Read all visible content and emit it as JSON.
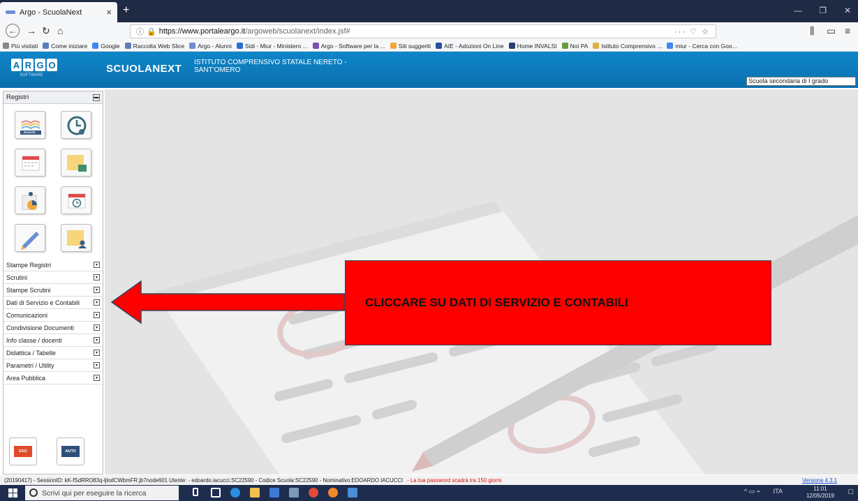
{
  "browser": {
    "tab_title": "Argo - ScuolaNext",
    "tab_close": "×",
    "new_tab": "+",
    "url_host": "https://www.portaleargo.it",
    "url_path": "/argoweb/scuolanext/index.jsf#",
    "url_actions": "··· ♡ ☆",
    "bookmarks": [
      "Più visitati",
      "Come iniziare",
      "Google",
      "Raccolta Web Slice",
      "Argo - Alunni",
      "Sidi - Miur - Ministero ...",
      "Argo - Software per la ...",
      "Siti suggeriti",
      "AIE - Adozioni On Line",
      "Home INVALSI",
      "Noi PA",
      "Istituto Comprensivo ...",
      "miur - Cerca con Goo..."
    ]
  },
  "app": {
    "logo_letters": [
      "A",
      "R",
      "G",
      "O"
    ],
    "logo_sub": "SOFTWARE",
    "product": "SCUOLANEXT",
    "school_line1": "ISTITUTO COMPRENSIVO STATALE NERETO -",
    "school_line2": "SANT'OMERO",
    "school_level": "Scuola secondaria di I grado"
  },
  "sidebar": {
    "registri_label": "Registri",
    "registri_icon_caption": "REGISTRI",
    "menu": [
      "Stampe Registri",
      "Scrutini",
      "Stampe Scrutini",
      "Dati di Servizio e Contabili",
      "Comunicazioni",
      "Condivisione Documenti",
      "Info classe / docenti",
      "Didattica / Tabelle",
      "Parametri / Utility",
      "Area Pubblica"
    ],
    "exit_label": "ESCI",
    "help_label": "AIUTO"
  },
  "annotation": {
    "text": "CLICCARE SU DATI DI SERVIZIO E CONTABILI",
    "color": "#ff0000"
  },
  "status": {
    "session": "(20190417) - SessionID: kK-fSdRRO83q-ljlodCWbmFR.jb7node601 Utente: - edoardo.iacucci.SC22590 - Codice Scuola:SC22590 - Nominativo:EDOARDO IACUCCI",
    "warning": "- La tua password scadrà tra 150 giorni",
    "version": "Versione 4.3.1"
  },
  "taskbar": {
    "search_placeholder": "Scrivi qui per eseguire la ricerca",
    "lang": "ITA",
    "time": "11:01",
    "date": "12/05/2019"
  }
}
